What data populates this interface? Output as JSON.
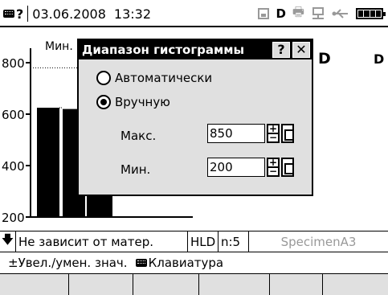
{
  "status": {
    "indicator": "?",
    "date": "03.06.2008",
    "time": "13:32",
    "flags": "D",
    "icons": [
      "keyboard-icon",
      "save-icon",
      "d-mode-icon",
      "printer-icon",
      "network-icon",
      "usb-icon",
      "battery-icon"
    ]
  },
  "chart": {
    "header_label": "Мин.",
    "header_d1": "D",
    "header_d2": "D",
    "y_ticks": [
      "800",
      "600",
      "400",
      "200"
    ]
  },
  "chart_data": {
    "type": "bar",
    "ylim": [
      200,
      850
    ],
    "y_ticks": [
      800,
      600,
      400,
      200
    ],
    "values": [
      625,
      620,
      600
    ],
    "reference_line": 780,
    "grid": false
  },
  "dialog": {
    "title": "Диапазон гистограммы",
    "help_label": "?",
    "close_label": "✕",
    "options": [
      {
        "label": "Автоматически",
        "selected": false
      },
      {
        "label": "Вручную",
        "selected": true
      }
    ],
    "max": {
      "label": "Макс.",
      "value": "850"
    },
    "min": {
      "label": "Мин.",
      "value": "200"
    }
  },
  "info_bar": {
    "arrow": "🡇",
    "material": "Не зависит от матер.",
    "hld": "HLD",
    "n": "n:5",
    "specimen": "SpecimenA3"
  },
  "hint_bar": {
    "adjust_symbol": "±",
    "adjust": "Увел./умен. знач.",
    "keyboard": "Клавиатура"
  },
  "softkeys": [
    "",
    "",
    "",
    "",
    "",
    ""
  ]
}
